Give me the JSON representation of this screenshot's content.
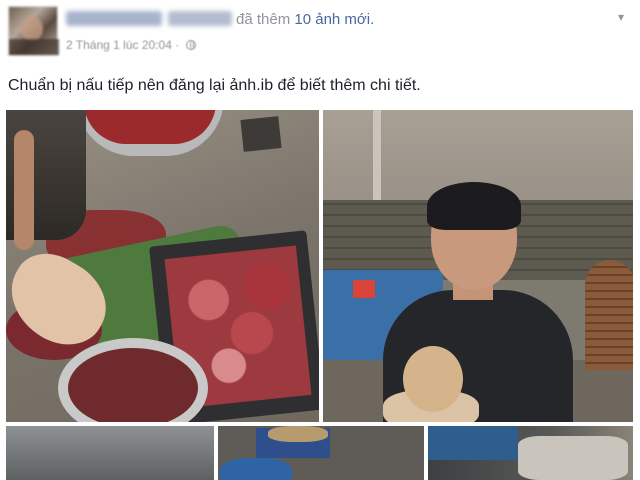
{
  "post": {
    "action_text": "đã thêm",
    "action_link": "10 ảnh mới.",
    "timestamp": "2 Tháng 1 lúc 20:04 ·",
    "caption": "Chuẩn bị nấu tiếp nên đăng lại ảnh.ib để biết thêm chi tiết."
  },
  "icons": {
    "privacy": "globe-icon",
    "menu": "chevron-down-icon"
  }
}
